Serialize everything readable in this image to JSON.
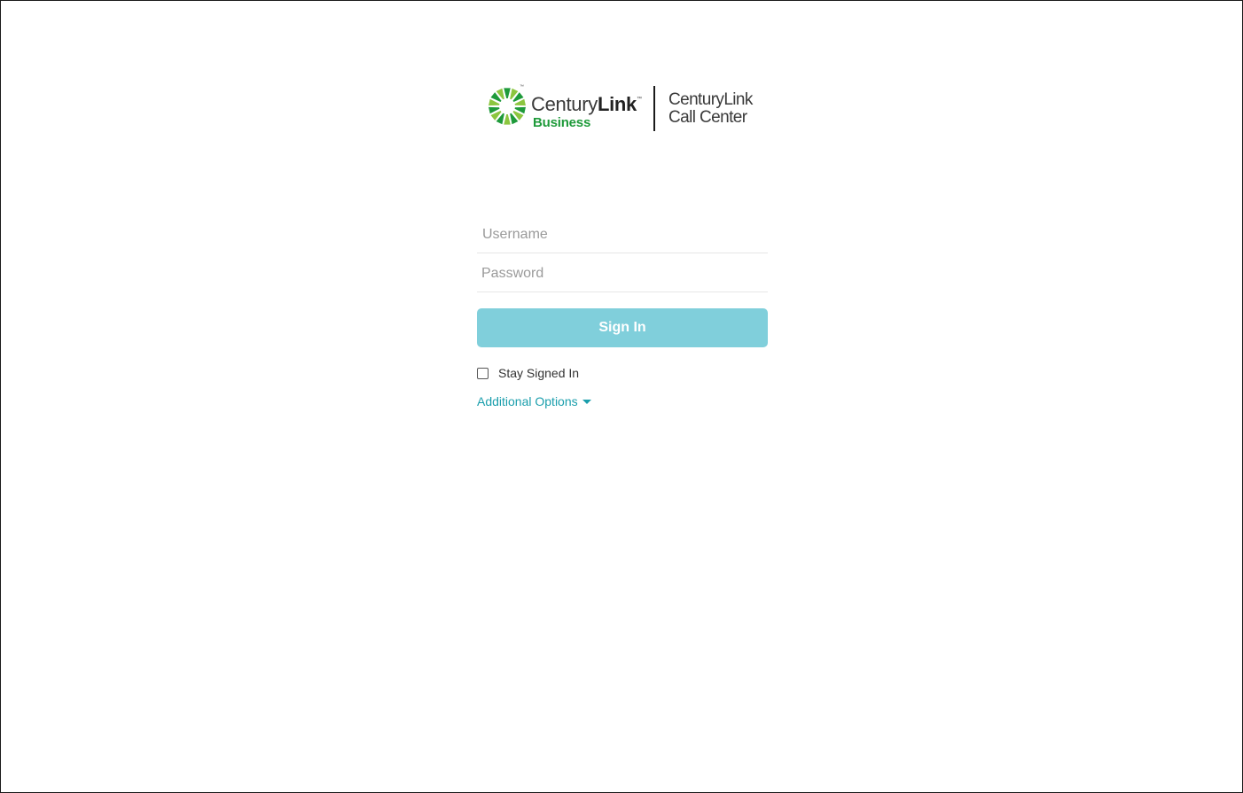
{
  "logo": {
    "brand_regular": "Century",
    "brand_bold": "Link",
    "trademark": "™",
    "sub": "Business",
    "product_line1": "CenturyLink",
    "product_line2": "Call Center",
    "colors": {
      "green_dark": "#1e9a3a",
      "green_light": "#8cc63f"
    }
  },
  "login": {
    "username_placeholder": "Username",
    "password_placeholder": "Password",
    "signin_label": "Sign In",
    "stay_signed_in_label": "Stay Signed In",
    "stay_signed_in_checked": false,
    "additional_options_label": "Additional Options"
  },
  "colors": {
    "button_bg": "#80cfdb",
    "link": "#1a9eac",
    "text": "#333333",
    "placeholder": "#9a9a9a"
  },
  "icons": {
    "logo": "sunburst-logo-icon",
    "caret": "caret-down-icon"
  }
}
